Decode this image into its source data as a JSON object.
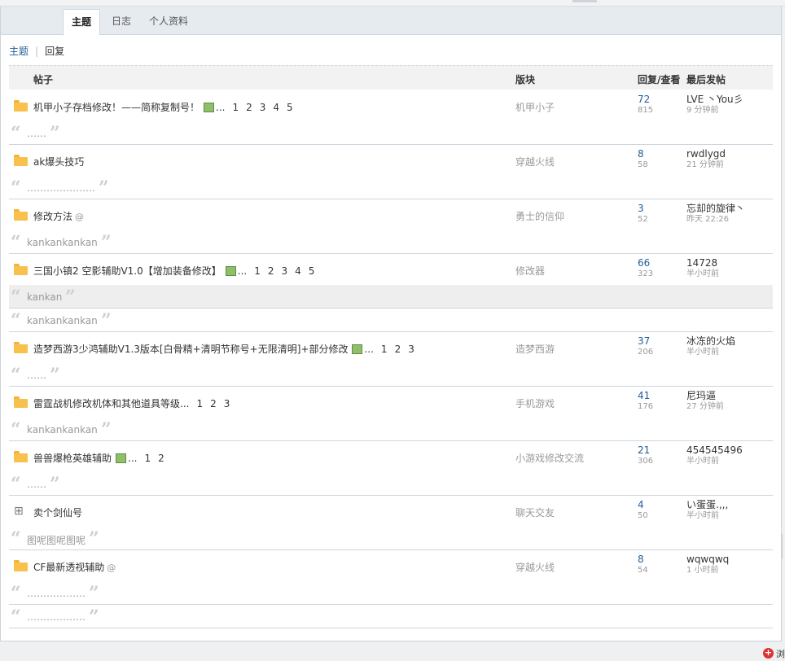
{
  "tabs": [
    "主题",
    "日志",
    "个人资料"
  ],
  "subnav": {
    "active": "主题",
    "separator": "|",
    "other": "回复"
  },
  "header": {
    "post": "帖子",
    "forum": "版块",
    "stats": "回复/查看",
    "last": "最后发帖"
  },
  "threads": [
    {
      "icon": "folder",
      "title": "机甲小子存档修改！——简称复制号！",
      "image": true,
      "attach": false,
      "ellipsis": "...",
      "pages": [
        "1",
        "2",
        "3",
        "4",
        "5"
      ],
      "forum": "机甲小子",
      "replies": "72",
      "views": "815",
      "user": "LVE 丶You彡",
      "time": "9 分钟前",
      "quotes": [
        {
          "text": "……",
          "gray": false
        }
      ]
    },
    {
      "icon": "folder",
      "title": "ak爆头技巧",
      "image": false,
      "attach": false,
      "ellipsis": "",
      "pages": [],
      "forum": "穿越火线",
      "replies": "8",
      "views": "58",
      "user": "rwdlygd",
      "time": "21 分钟前",
      "quotes": [
        {
          "text": "…………………",
          "gray": false
        }
      ]
    },
    {
      "icon": "folder",
      "title": "修改方法",
      "image": false,
      "attach": true,
      "ellipsis": "",
      "pages": [],
      "forum": "勇士的信仰",
      "replies": "3",
      "views": "52",
      "user": "忘却的旋律丶",
      "time": "昨天 22:26",
      "quotes": [
        {
          "text": "kankankankan",
          "gray": false
        }
      ]
    },
    {
      "icon": "folder",
      "title": "三国小镇2 空影辅助V1.0【增加装备修改】",
      "image": true,
      "attach": false,
      "ellipsis": "...",
      "pages": [
        "1",
        "2",
        "3",
        "4",
        "5"
      ],
      "forum": "修改器",
      "replies": "66",
      "views": "323",
      "user": "14728",
      "time": "半小时前",
      "quotes": [
        {
          "text": "kankan",
          "gray": true
        },
        {
          "text": "kankankankan",
          "gray": false
        }
      ]
    },
    {
      "icon": "folder",
      "title": "造梦西游3少鸿辅助V1.3版本[白骨精+清明节称号+无限清明]+部分修改",
      "image": true,
      "attach": false,
      "ellipsis": "...",
      "pages": [
        "1",
        "2",
        "3"
      ],
      "forum": "造梦西游",
      "replies": "37",
      "views": "206",
      "user": "冰冻的火焰",
      "time": "半小时前",
      "quotes": [
        {
          "text": "……",
          "gray": false
        }
      ]
    },
    {
      "icon": "folder",
      "title": "雷霆战机修改机体和其他道具等级",
      "image": false,
      "attach": false,
      "ellipsis": "...",
      "pages": [
        "1",
        "2",
        "3"
      ],
      "forum": "手机游戏",
      "replies": "41",
      "views": "176",
      "user": "尼玛逼",
      "time": "27 分钟前",
      "quotes": [
        {
          "text": "kankankankan",
          "gray": false
        }
      ]
    },
    {
      "icon": "folder",
      "title": "兽兽爆枪英雄辅助",
      "image": true,
      "attach": false,
      "ellipsis": "...",
      "pages": [
        "1",
        "2"
      ],
      "forum": "小游戏修改交流",
      "replies": "21",
      "views": "306",
      "user": "454545496",
      "time": "半小时前",
      "quotes": [
        {
          "text": "……",
          "gray": false
        }
      ]
    },
    {
      "icon": "cart",
      "title": "卖个剑仙号",
      "image": false,
      "attach": false,
      "ellipsis": "",
      "pages": [],
      "forum": "聊天交友",
      "replies": "4",
      "views": "50",
      "user": "い蛋蛋.,,,",
      "time": "半小时前",
      "quotes": [
        {
          "text": "图呢图呢图呢",
          "gray": false
        }
      ]
    },
    {
      "icon": "folder",
      "title": "CF最新透视辅助",
      "image": false,
      "attach": true,
      "ellipsis": "",
      "pages": [],
      "forum": "穿越火线",
      "replies": "8",
      "views": "54",
      "user": "wqwqwq",
      "time": "1 小时前",
      "quotes": [
        {
          "text": "………………",
          "gray": false
        },
        {
          "text": "………………",
          "gray": false
        }
      ]
    }
  ],
  "corner": {
    "text": "浏"
  }
}
